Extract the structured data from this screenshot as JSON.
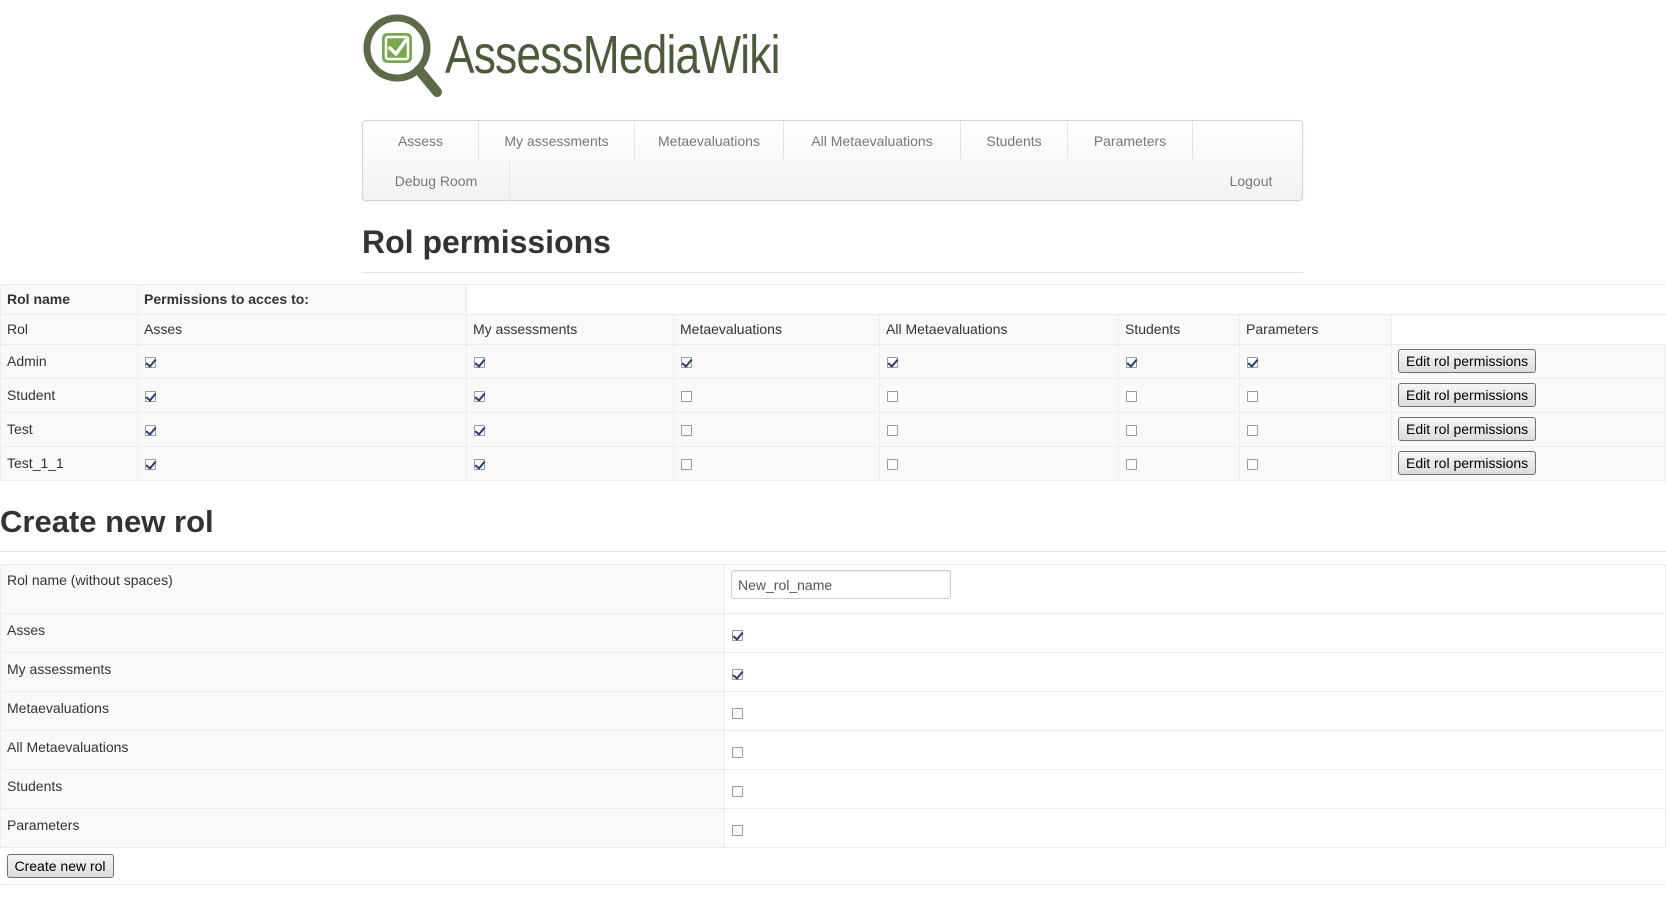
{
  "logo": {
    "text": "AssessMediaWiki",
    "color": "#4a5a3a"
  },
  "nav": {
    "items": [
      "Assess",
      "My assessments",
      "Metaevaluations",
      "All Metaevaluations",
      "Students",
      "Parameters",
      "Debug Room"
    ],
    "logout": "Logout"
  },
  "permissions": {
    "title": "Rol permissions",
    "header_rol_name": "Rol name",
    "header_permissions": "Permissions to acces to:",
    "columns": [
      "Rol",
      "Asses",
      "My assessments",
      "Metaevaluations",
      "All Metaevaluations",
      "Students",
      "Parameters"
    ],
    "edit_label": "Edit rol permissions",
    "rows": [
      {
        "name": "Admin",
        "perms": [
          true,
          true,
          true,
          true,
          true,
          true
        ]
      },
      {
        "name": "Student",
        "perms": [
          true,
          true,
          false,
          false,
          false,
          false
        ]
      },
      {
        "name": "Test",
        "perms": [
          true,
          true,
          false,
          false,
          false,
          false
        ]
      },
      {
        "name": "Test_1_1",
        "perms": [
          true,
          true,
          false,
          false,
          false,
          false
        ]
      }
    ]
  },
  "create": {
    "title": "Create new rol",
    "name_label": "Rol name (without spaces)",
    "name_value": "New_rol_name",
    "options": [
      {
        "label": "Asses",
        "checked": true
      },
      {
        "label": "My assessments",
        "checked": true
      },
      {
        "label": "Metaevaluations",
        "checked": false
      },
      {
        "label": "All Metaevaluations",
        "checked": false
      },
      {
        "label": "Students",
        "checked": false
      },
      {
        "label": "Parameters",
        "checked": false
      }
    ],
    "button_label": "Create new rol"
  }
}
